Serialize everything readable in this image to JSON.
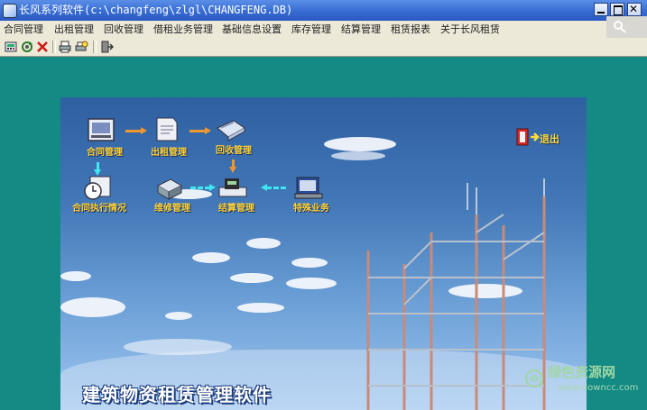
{
  "window": {
    "title": "长风系列软件(c:\\changfeng\\zlgl\\CHANGFENG.DB)"
  },
  "menu": [
    {
      "label": "合同管理"
    },
    {
      "label": "出租管理"
    },
    {
      "label": "回收管理"
    },
    {
      "label": "借租业务管理"
    },
    {
      "label": "基础信息设置"
    },
    {
      "label": "库存管理"
    },
    {
      "label": "结算管理"
    },
    {
      "label": "租赁报表"
    },
    {
      "label": "关于长风租赁"
    }
  ],
  "toolbar": {
    "icons": [
      "calculator-icon",
      "refresh-icon",
      "delete-icon",
      "print-icon",
      "printer-preview-icon",
      "exit-door-icon"
    ]
  },
  "main": {
    "modules": {
      "contract": "合同管理",
      "rent_out": "出租管理",
      "recycle": "回收管理",
      "contract_exec": "合同执行情况",
      "repair": "维修管理",
      "settle": "结算管理",
      "special": "特殊业务"
    },
    "exit_label": "退出",
    "banner_title": "建筑物资租赁管理软件"
  },
  "watermark": {
    "text": "绿色资源网",
    "url": "www.downcc.com"
  },
  "colors": {
    "title_bar": "#3a6fd6",
    "desktop": "#138a84",
    "label_yellow": "#ffd23a",
    "flow_orange": "#f0962e",
    "flow_cyan": "#40e6f0"
  }
}
